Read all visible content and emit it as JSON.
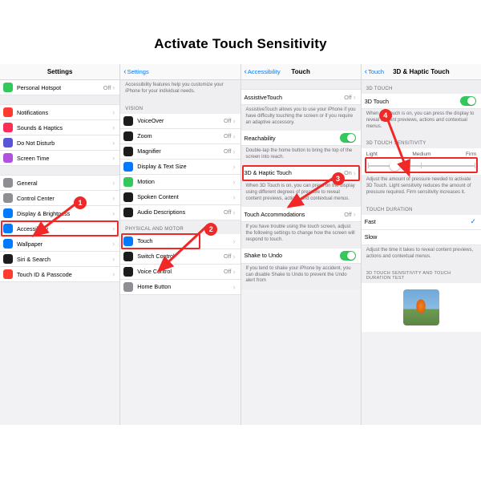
{
  "title": "Activate Touch Sensitivity",
  "steps": {
    "s1": "1",
    "s2": "2",
    "s3": "3",
    "s4": "4"
  },
  "p1": {
    "header": "Settings",
    "items": [
      {
        "label": "Personal Hotspot",
        "value": "Off",
        "color": "ic-green"
      },
      {
        "label": "Notifications",
        "color": "ic-red"
      },
      {
        "label": "Sounds & Haptics",
        "color": "ic-pink"
      },
      {
        "label": "Do Not Disturb",
        "color": "ic-purple"
      },
      {
        "label": "Screen Time",
        "color": "ic-purple2"
      },
      {
        "label": "General",
        "color": "ic-gray"
      },
      {
        "label": "Control Center",
        "color": "ic-gray"
      },
      {
        "label": "Display & Brightness",
        "color": "ic-blue"
      },
      {
        "label": "Accessibility",
        "color": "ic-blue",
        "highlight": true
      },
      {
        "label": "Wallpaper",
        "color": "ic-blue"
      },
      {
        "label": "Siri & Search",
        "color": "ic-black"
      },
      {
        "label": "Touch ID & Passcode",
        "color": "ic-red"
      }
    ]
  },
  "p2": {
    "back": "Settings",
    "intro": "Accessibility features help you customize your iPhone for your individual needs.",
    "section_vision": "VISION",
    "vision": [
      {
        "label": "VoiceOver",
        "value": "Off"
      },
      {
        "label": "Zoom",
        "value": "Off"
      },
      {
        "label": "Magnifier",
        "value": "Off"
      },
      {
        "label": "Display & Text Size"
      },
      {
        "label": "Motion"
      },
      {
        "label": "Spoken Content"
      },
      {
        "label": "Audio Descriptions",
        "value": "Off"
      }
    ],
    "section_motor": "PHYSICAL AND MOTOR",
    "motor": [
      {
        "label": "Touch",
        "highlight": true
      },
      {
        "label": "Switch Control",
        "value": "Off"
      },
      {
        "label": "Voice Control",
        "value": "Off"
      },
      {
        "label": "Home Button"
      }
    ]
  },
  "p3": {
    "back": "Accessibility",
    "title": "Touch",
    "rows": {
      "assistive": {
        "label": "AssistiveTouch",
        "value": "Off"
      },
      "assistive_desc": "AssistiveTouch allows you to use your iPhone if you have difficulty touching the screen or if you require an adaptive accessory.",
      "reach": {
        "label": "Reachability"
      },
      "reach_desc": "Double-tap the home button to bring the top of the screen into reach.",
      "haptic": {
        "label": "3D & Haptic Touch",
        "value": "On",
        "highlight": true
      },
      "haptic_desc": "When 3D Touch is on, you can press on the display using different degrees of pressure to reveal content previews, actions and contextual menus.",
      "accom": {
        "label": "Touch Accommodations",
        "value": "Off"
      },
      "accom_desc": "If you have trouble using the touch screen, adjust the following settings to change how the screen will respond to touch.",
      "shake": {
        "label": "Shake to Undo"
      },
      "shake_desc": "If you tend to shake your iPhone by accident, you can disable Shake to Undo to prevent the Undo alert from"
    }
  },
  "p4": {
    "back": "Touch",
    "title": "3D & Haptic Touch",
    "section_3d": "3D TOUCH",
    "row_3d": {
      "label": "3D Touch"
    },
    "desc_3d": "When 3D Touch is on, you can press the display to reveal content previews, actions and contextual menus.",
    "section_sens": "3D TOUCH SENSITIVITY",
    "seg": {
      "light": "Light",
      "medium": "Medium",
      "firm": "Firm"
    },
    "sens_desc": "Adjust the amount of pressure needed to activate 3D Touch. Light sensitivity reduces the amount of pressure required. Firm sensitivity increases it.",
    "section_dur": "TOUCH DURATION",
    "dur_fast": "Fast",
    "dur_slow": "Slow",
    "dur_desc": "Adjust the time it takes to reveal content previews, actions and contextual menus.",
    "section_test": "3D TOUCH SENSITIVITY AND TOUCH DURATION TEST"
  }
}
